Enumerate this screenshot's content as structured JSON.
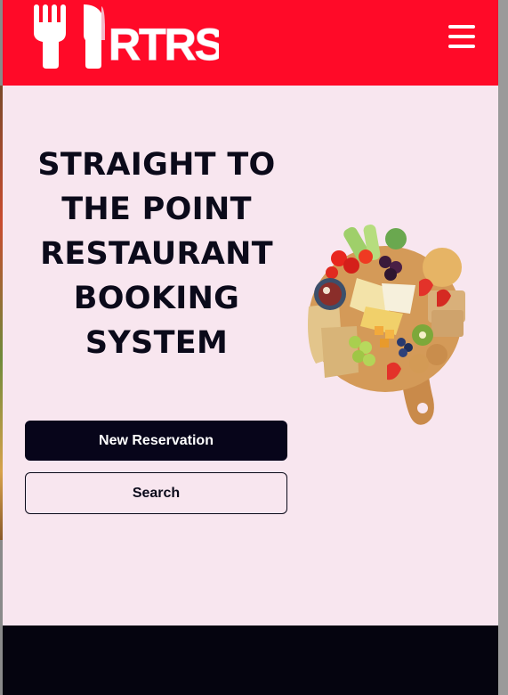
{
  "brand": {
    "logo_text": "RTRS",
    "colors": {
      "header": "#ff0a28",
      "page_bg": "#f8e6ef",
      "dark": "#07051a"
    }
  },
  "header": {
    "menu_icon": "hamburger-menu-icon"
  },
  "hero": {
    "title": "STRAIGHT TO THE POINT RESTAURANT BOOKING SYSTEM",
    "image": "charcuterie-board-image"
  },
  "actions": {
    "new_reservation_label": "New Reservation",
    "search_label": "Search"
  }
}
